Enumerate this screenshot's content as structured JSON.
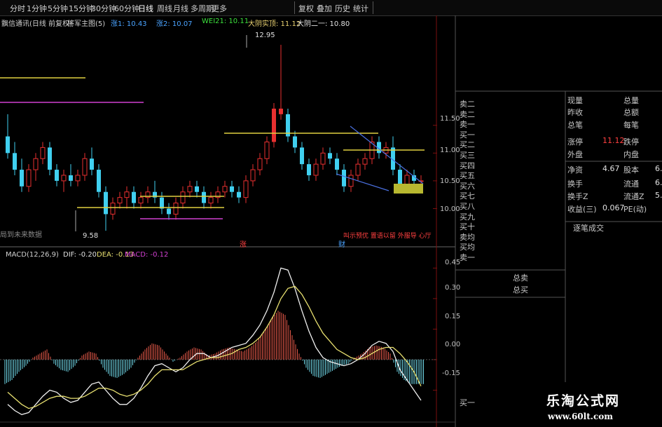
{
  "toolbar": {
    "periods": [
      "分时",
      "1分钟",
      "5分钟",
      "15分钟",
      "30分钟",
      "60分钟",
      "日线",
      "周线",
      "月线",
      "多周期",
      "更多"
    ],
    "right_buttons": [
      "复权",
      "叠加",
      "历史",
      "统计"
    ]
  },
  "header": {
    "stock_name": "飘信通讯(日线 前复权)",
    "indicator": "将军主图(5)",
    "gain1": "涨1: 10.43",
    "gain2": "涨2: 10.07",
    "wei": "WEI21: 10.11",
    "big_line": "大阴实顶: 11.12",
    "big_line2": "大阴二一: 10.80"
  },
  "main_chart": {
    "high_label": "12.95",
    "low_label": "9.58",
    "no_data_label": "局到未来数据",
    "marker_red": "涨",
    "marker_blue": "财",
    "bottom_note": "叫示预优 置语以留 外服导 心厅",
    "y_ticks": [
      "11.50",
      "11.00",
      "10.50",
      "10.00"
    ]
  },
  "macd": {
    "title": "MACD(12,26,9)",
    "dif": "DIF: -0.20",
    "dea": "DEA: -0.13",
    "macd": "MACD: -0.12",
    "y_ticks": [
      "0.45",
      "0.30",
      "0.15",
      "0.00",
      "-0.15"
    ]
  },
  "quote_panel": {
    "order_rows_top": [
      "卖二",
      "卖二",
      "卖一",
      "买一",
      "买二",
      "买三",
      "买四",
      "买五",
      "买六",
      "买七",
      "买八",
      "买九",
      "买十",
      "卖均",
      "买均",
      "卖一"
    ],
    "total_sell": "总卖",
    "total_buy": "总买",
    "bottom_row": "买一",
    "stats": [
      {
        "k1": "现量",
        "v1": "",
        "k2": "总量",
        "v2": ""
      },
      {
        "k1": "昨收",
        "v1": "",
        "k2": "总额",
        "v2": ""
      },
      {
        "k1": "总笔",
        "v1": "",
        "k2": "每笔",
        "v2": ""
      },
      {
        "k1": "涨停",
        "v1": "11.12",
        "k2": "跌停",
        "v2": ""
      },
      {
        "k1": "外盘",
        "v1": "",
        "k2": "内盘",
        "v2": ""
      },
      {
        "k1": "净资",
        "v1": "4.67",
        "k2": "股本",
        "v2": "6."
      },
      {
        "k1": "换手",
        "v1": "",
        "k2": "流通",
        "v2": "6."
      },
      {
        "k1": "换手Z",
        "v1": "",
        "k2": "流通Z",
        "v2": "5."
      },
      {
        "k1": "收益(三)",
        "v1": "0.067",
        "k2": "PE(动)",
        "v2": ""
      }
    ],
    "trade_detail": "逐笔成交"
  },
  "logo": {
    "line1": "乐淘公式网",
    "line2": "www.60lt.com"
  },
  "chart_data": [
    {
      "type": "candlestick",
      "title": "将军主图(5)",
      "y_ticks": [
        10.0,
        10.5,
        11.0,
        11.5
      ],
      "ylim": [
        9.4,
        13.1
      ],
      "candles": [
        [
          11.3,
          11.7,
          10.9,
          11.0
        ],
        [
          11.0,
          11.2,
          10.6,
          10.7
        ],
        [
          10.7,
          10.9,
          10.3,
          10.4
        ],
        [
          10.4,
          10.8,
          10.3,
          10.7
        ],
        [
          10.7,
          11.0,
          10.5,
          10.9
        ],
        [
          10.9,
          11.2,
          10.8,
          11.1
        ],
        [
          11.1,
          11.2,
          10.6,
          10.7
        ],
        [
          10.7,
          10.8,
          10.4,
          10.5
        ],
        [
          10.5,
          10.7,
          10.3,
          10.6
        ],
        [
          10.6,
          10.8,
          10.4,
          10.5
        ],
        [
          10.5,
          10.7,
          10.4,
          10.6
        ],
        [
          10.6,
          11.0,
          10.5,
          10.9
        ],
        [
          10.9,
          11.1,
          10.6,
          10.7
        ],
        [
          10.7,
          10.8,
          10.2,
          10.3
        ],
        [
          10.3,
          10.4,
          9.6,
          9.9
        ],
        [
          9.9,
          10.2,
          9.8,
          10.1
        ],
        [
          10.1,
          10.3,
          10.0,
          10.2
        ],
        [
          10.2,
          10.4,
          10.0,
          10.3
        ],
        [
          10.3,
          10.4,
          10.0,
          10.1
        ],
        [
          10.1,
          10.3,
          10.0,
          10.2
        ],
        [
          10.2,
          10.4,
          10.1,
          10.3
        ],
        [
          10.3,
          10.5,
          10.1,
          10.2
        ],
        [
          10.2,
          10.3,
          9.9,
          10.0
        ],
        [
          10.0,
          10.1,
          9.8,
          9.9
        ],
        [
          9.9,
          10.2,
          9.8,
          10.1
        ],
        [
          10.1,
          10.4,
          10.0,
          10.3
        ],
        [
          10.3,
          10.5,
          10.2,
          10.4
        ],
        [
          10.4,
          10.5,
          10.2,
          10.3
        ],
        [
          10.3,
          10.4,
          10.0,
          10.1
        ],
        [
          10.1,
          10.3,
          10.0,
          10.2
        ],
        [
          10.2,
          10.4,
          10.1,
          10.3
        ],
        [
          10.3,
          10.5,
          10.2,
          10.4
        ],
        [
          10.4,
          10.5,
          10.2,
          10.3
        ],
        [
          10.3,
          10.4,
          10.1,
          10.2
        ],
        [
          10.2,
          10.6,
          10.1,
          10.5
        ],
        [
          10.5,
          10.8,
          10.4,
          10.7
        ],
        [
          10.7,
          11.0,
          10.6,
          10.9
        ],
        [
          10.9,
          11.3,
          10.8,
          11.2
        ],
        [
          11.2,
          11.9,
          11.1,
          11.8
        ],
        [
          11.8,
          12.95,
          11.6,
          11.7
        ],
        [
          11.7,
          11.8,
          11.2,
          11.3
        ],
        [
          11.3,
          11.4,
          11.0,
          11.1
        ],
        [
          11.1,
          11.2,
          10.7,
          10.8
        ],
        [
          10.8,
          10.9,
          10.5,
          10.6
        ],
        [
          10.6,
          10.9,
          10.5,
          10.8
        ],
        [
          10.8,
          11.1,
          10.7,
          11.0
        ],
        [
          11.0,
          11.1,
          10.8,
          10.9
        ],
        [
          10.9,
          11.0,
          10.6,
          10.7
        ],
        [
          10.7,
          10.8,
          10.3,
          10.4
        ],
        [
          10.4,
          10.7,
          10.3,
          10.6
        ],
        [
          10.6,
          10.9,
          10.5,
          10.8
        ],
        [
          10.8,
          11.0,
          10.7,
          10.9
        ],
        [
          10.9,
          11.3,
          10.8,
          11.2
        ],
        [
          11.2,
          11.3,
          10.9,
          11.0
        ],
        [
          11.0,
          11.2,
          10.9,
          11.1
        ],
        [
          11.1,
          11.3,
          10.6,
          10.7
        ],
        [
          10.7,
          10.8,
          10.3,
          10.4
        ],
        [
          10.4,
          10.7,
          10.3,
          10.6
        ],
        [
          10.6,
          10.7,
          10.4,
          10.5
        ],
        [
          10.5,
          10.6,
          10.4,
          10.5
        ]
      ]
    },
    {
      "type": "bar+line",
      "title": "MACD(12,26,9)",
      "y_ticks": [
        -0.15,
        0.0,
        0.15,
        0.3,
        0.45
      ],
      "ylim": [
        -0.3,
        0.52
      ],
      "series": [
        {
          "name": "MACD",
          "values": [
            -0.12,
            -0.1,
            -0.06,
            -0.03,
            0.01,
            0.03,
            0.05,
            -0.02,
            -0.05,
            -0.06,
            -0.03,
            0.02,
            0.04,
            0.03,
            -0.04,
            -0.08,
            -0.09,
            -0.07,
            -0.04,
            0.01,
            0.05,
            0.08,
            0.07,
            0.03,
            -0.01,
            0.01,
            0.04,
            0.06,
            0.05,
            0.02,
            0.03,
            0.05,
            0.06,
            0.05,
            0.04,
            0.06,
            0.09,
            0.14,
            0.2,
            0.24,
            0.22,
            0.12,
            0.03,
            -0.04,
            -0.08,
            -0.09,
            -0.07,
            -0.05,
            -0.03,
            -0.02,
            0.01,
            0.03,
            0.06,
            0.07,
            0.06,
            0.03,
            -0.06,
            -0.1,
            -0.12,
            -0.12
          ]
        },
        {
          "name": "DIF",
          "values": [
            -0.22,
            -0.25,
            -0.27,
            -0.26,
            -0.22,
            -0.18,
            -0.15,
            -0.16,
            -0.19,
            -0.21,
            -0.2,
            -0.16,
            -0.12,
            -0.11,
            -0.15,
            -0.19,
            -0.22,
            -0.22,
            -0.19,
            -0.14,
            -0.08,
            -0.03,
            -0.02,
            -0.04,
            -0.06,
            -0.04,
            0.0,
            0.03,
            0.03,
            0.01,
            0.02,
            0.04,
            0.06,
            0.07,
            0.08,
            0.12,
            0.17,
            0.24,
            0.33,
            0.45,
            0.44,
            0.35,
            0.24,
            0.14,
            0.06,
            0.01,
            -0.01,
            -0.02,
            -0.03,
            -0.02,
            0.0,
            0.03,
            0.07,
            0.09,
            0.08,
            0.04,
            -0.05,
            -0.1,
            -0.15,
            -0.2
          ]
        },
        {
          "name": "DEA",
          "values": [
            -0.16,
            -0.19,
            -0.22,
            -0.24,
            -0.23,
            -0.21,
            -0.19,
            -0.18,
            -0.18,
            -0.19,
            -0.19,
            -0.18,
            -0.16,
            -0.14,
            -0.14,
            -0.15,
            -0.17,
            -0.18,
            -0.17,
            -0.15,
            -0.12,
            -0.08,
            -0.05,
            -0.05,
            -0.05,
            -0.05,
            -0.03,
            -0.01,
            0.0,
            0.01,
            0.01,
            0.02,
            0.03,
            0.05,
            0.06,
            0.08,
            0.11,
            0.16,
            0.22,
            0.3,
            0.35,
            0.36,
            0.32,
            0.26,
            0.19,
            0.13,
            0.09,
            0.05,
            0.03,
            0.01,
            0.0,
            0.01,
            0.03,
            0.05,
            0.06,
            0.06,
            0.03,
            -0.01,
            -0.06,
            -0.13
          ]
        }
      ]
    }
  ]
}
